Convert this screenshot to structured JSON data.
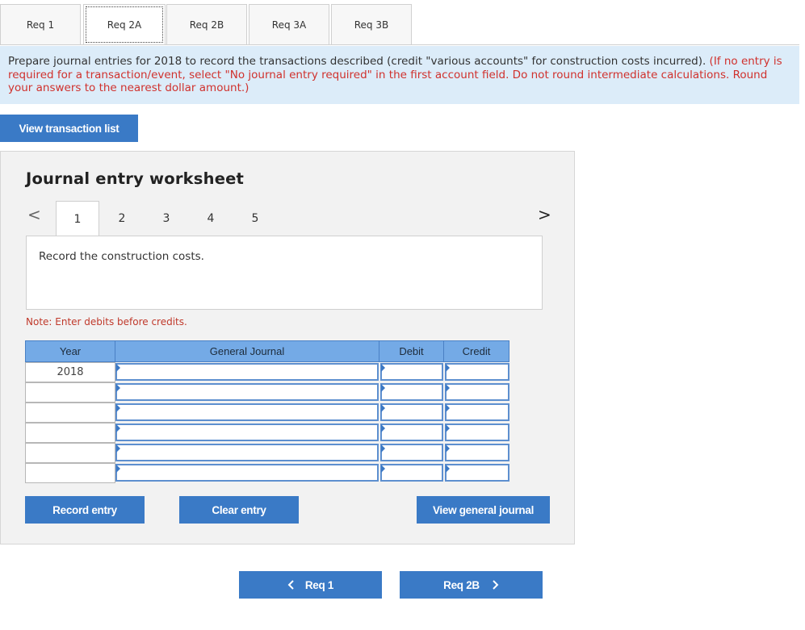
{
  "tabs": [
    "Req 1",
    "Req 2A",
    "Req 2B",
    "Req 3A",
    "Req 3B"
  ],
  "instructions": {
    "main": "Prepare journal entries for 2018 to record the transactions described (credit \"various accounts\" for construction costs incurred). ",
    "red": "(If no entry is required for a transaction/event, select \"No journal entry required\" in the first account field. Do not round intermediate calculations. Round your answers to the nearest dollar amount.)"
  },
  "view_transaction_list": "View transaction list",
  "worksheet": {
    "title": "Journal entry worksheet",
    "prev_arrow": "<",
    "next_arrow": ">",
    "pages": [
      "1",
      "2",
      "3",
      "4",
      "5"
    ],
    "active_page": "1",
    "description": "Record the construction costs.",
    "note": "Note: Enter debits before credits.",
    "columns": [
      "Year",
      "General Journal",
      "Debit",
      "Credit"
    ],
    "rows": [
      {
        "year": "2018",
        "account": "",
        "debit": "",
        "credit": ""
      },
      {
        "year": "",
        "account": "",
        "debit": "",
        "credit": ""
      },
      {
        "year": "",
        "account": "",
        "debit": "",
        "credit": ""
      },
      {
        "year": "",
        "account": "",
        "debit": "",
        "credit": ""
      },
      {
        "year": "",
        "account": "",
        "debit": "",
        "credit": ""
      },
      {
        "year": "",
        "account": "",
        "debit": "",
        "credit": ""
      }
    ],
    "record_entry": "Record entry",
    "clear_entry": "Clear entry",
    "view_general_journal": "View general journal"
  },
  "footer_nav": {
    "prev_label": "Req 1",
    "next_label": "Req 2B",
    "prev_icon": "chevron-left-icon",
    "next_icon": "chevron-right-icon"
  },
  "colors": {
    "button_blue": "#3a7ac6",
    "banner_bg": "#dcecf9",
    "table_header": "#74aae6",
    "note_red": "#c0392b"
  }
}
